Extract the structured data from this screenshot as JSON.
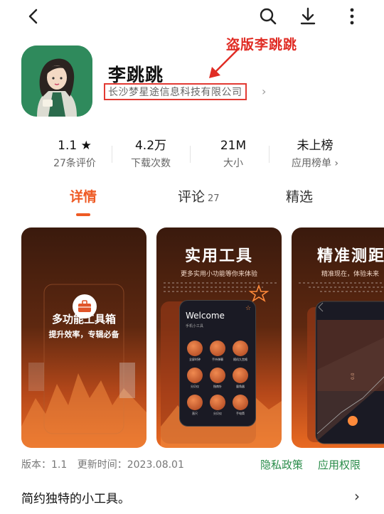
{
  "app": {
    "title": "李跳跳",
    "developer": "长沙梦星途信息科技有限公司",
    "annotation": "盗版李跳跳"
  },
  "stats": [
    {
      "value": "1.1 ★",
      "label": "27条评价"
    },
    {
      "value": "4.2万",
      "label": "下载次数"
    },
    {
      "value": "21M",
      "label": "大小"
    },
    {
      "value": "未上榜",
      "label": "应用榜单 ›"
    }
  ],
  "tabs": [
    {
      "label": "详情",
      "count": ""
    },
    {
      "label": "评论",
      "count": "27"
    },
    {
      "label": "精选",
      "count": ""
    }
  ],
  "screenshots": {
    "s1": {
      "headline": "多功能工具箱",
      "sub": "提升效率，专辑必备"
    },
    "s2": {
      "headline": "实用工具",
      "sub": "更多实用小功能等你来体验",
      "welcome": "Welcome",
      "phone_sub": "手机小工具",
      "tools": [
        "全屏时钟",
        "手持弹幕",
        "随机九宫格",
        "分贝仪",
        "指南针",
        "量角器",
        "直尺",
        "分贝仪",
        "手电筒"
      ]
    },
    "s3": {
      "headline": "精准测距",
      "sub": "精准现在，体验未来"
    }
  },
  "meta": {
    "version": "版本：1.1",
    "updated": "更新时间：2023.08.01",
    "privacy": "隐私政策",
    "permissions": "应用权限"
  },
  "description": "简约独特的小工具。",
  "colors": {
    "accent": "#ee5a24",
    "link": "#2a8c4a",
    "annotation": "#e02c24",
    "icon_bg": "#2f8a5c"
  },
  "icons": [
    "back-icon",
    "search-icon",
    "download-icon",
    "more-icon",
    "star-icon",
    "chevron-right-icon",
    "toolbox-icon"
  ]
}
